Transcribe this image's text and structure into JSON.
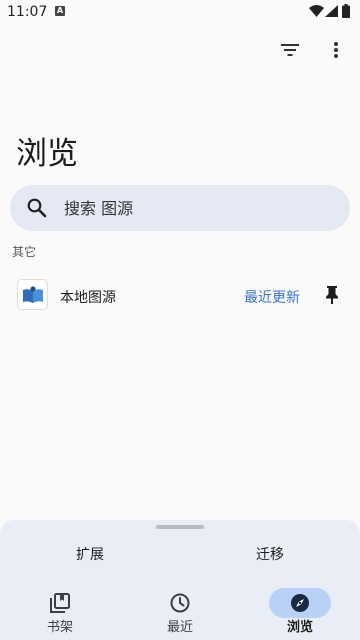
{
  "status": {
    "time": "11:07",
    "badge": "A"
  },
  "toolbar": {
    "filter_icon": "filter-icon",
    "more_icon": "more-vert-icon"
  },
  "title": "浏览",
  "search": {
    "placeholder": "搜索 图源"
  },
  "section_label": "其它",
  "sources": [
    {
      "name": "本地图源",
      "latest": "最近更新",
      "icon": "local-source-icon",
      "pin_icon": "pin-icon"
    }
  ],
  "sheet": {
    "actions": [
      "扩展",
      "迁移"
    ]
  },
  "nav": {
    "items": [
      {
        "label": "书架",
        "icon": "library-icon"
      },
      {
        "label": "最近",
        "icon": "clock-icon"
      },
      {
        "label": "浏览",
        "icon": "compass-icon",
        "active": true
      }
    ]
  },
  "colors": {
    "accent": "#3a73c8",
    "active_pill": "#b9d1f7",
    "sheet_bg": "#e9edf5",
    "search_bg": "#e4e9f3"
  }
}
